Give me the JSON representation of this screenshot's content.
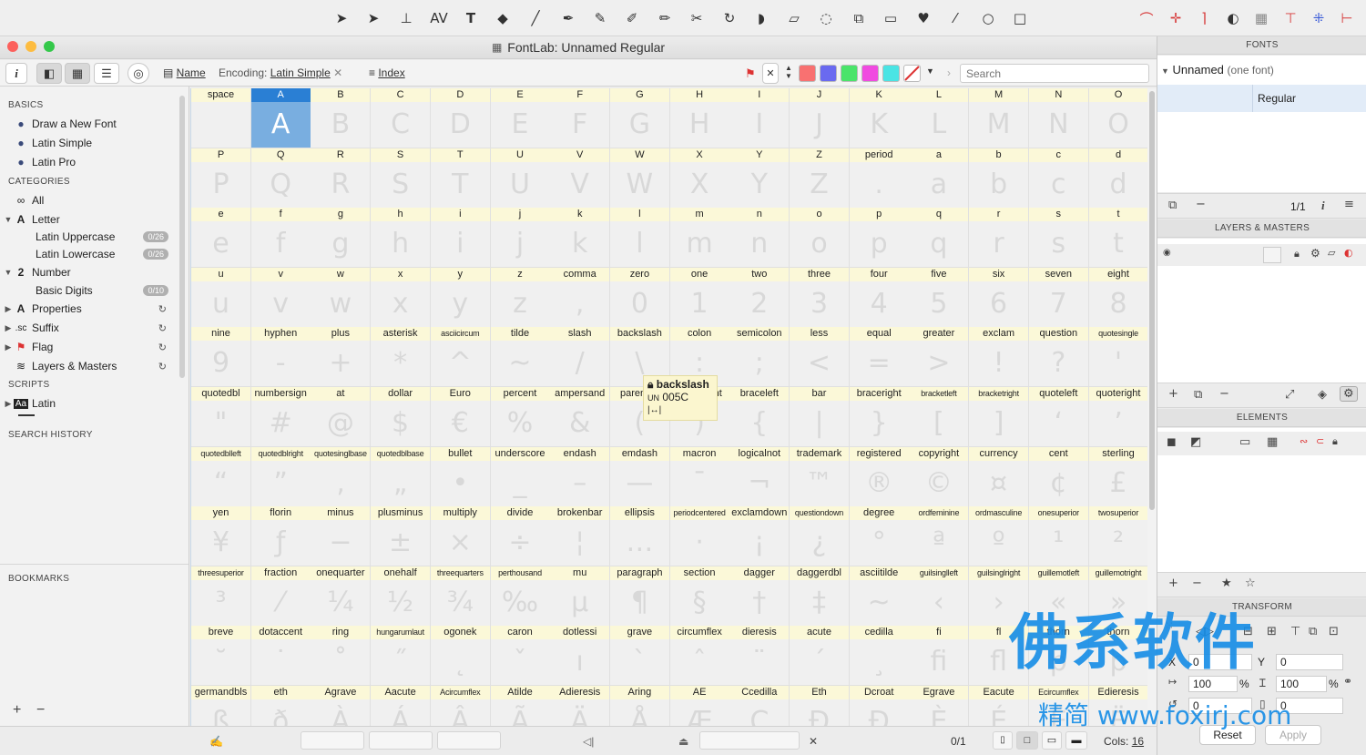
{
  "toolbar": {
    "left_icons": [
      "pointer-icon",
      "contour-pointer-icon",
      "metrics-icon",
      "kerning-icon",
      "text-icon",
      "eraser-icon",
      "brush-icon",
      "pen-icon",
      "calligraphy-icon",
      "pencil-icon",
      "rapidograph-icon",
      "knife-icon",
      "rotate-icon",
      "fill-icon",
      "ruler-icon",
      "lasso-icon",
      "transform-icon",
      "shape-icon",
      "blob-icon",
      "eyedropper-icon",
      "ellipse-icon",
      "rectangle-icon"
    ],
    "right_icons": [
      "curve-tool-icon",
      "node-tool-icon",
      "corner-tool-icon",
      "circle-tool-icon",
      "grid-tool-icon",
      "guide-tool-icon",
      "anchor-tool-icon",
      "hint-tool-icon"
    ]
  },
  "window": {
    "title": "FontLab: Unnamed Regular"
  },
  "subbar": {
    "name_label": "Name",
    "encoding_label": "Encoding:",
    "encoding_value": "Latin Simple",
    "index_label": "Index",
    "search_placeholder": "Search",
    "swatches": [
      "#f87171",
      "#6a6af0",
      "#4ae46a",
      "#f04ae0",
      "#4ae4e4"
    ]
  },
  "sidebar": {
    "basics_head": "BASICS",
    "basics": [
      "Draw a New Font",
      "Latin Simple",
      "Latin Pro"
    ],
    "categories_head": "CATEGORIES",
    "all": "All",
    "letter": "Letter",
    "latin_uppercase": "Latin Uppercase",
    "latin_uppercase_badge": "0/26",
    "latin_lowercase": "Latin Lowercase",
    "latin_lowercase_badge": "0/26",
    "number": "Number",
    "basic_digits": "Basic Digits",
    "basic_digits_badge": "0/10",
    "properties": "Properties",
    "suffix": "Suffix",
    "flag": "Flag",
    "layers_masters": "Layers & Masters",
    "scripts_head": "SCRIPTS",
    "latin": "Latin",
    "search_history_head": "SEARCH HISTORY",
    "bookmarks_head": "BOOKMARKS"
  },
  "glyphs": {
    "names": [
      "space",
      "A",
      "B",
      "C",
      "D",
      "E",
      "F",
      "G",
      "H",
      "I",
      "J",
      "K",
      "L",
      "M",
      "N",
      "O",
      "P",
      "Q",
      "R",
      "S",
      "T",
      "U",
      "V",
      "W",
      "X",
      "Y",
      "Z",
      "period",
      "a",
      "b",
      "c",
      "d",
      "e",
      "f",
      "g",
      "h",
      "i",
      "j",
      "k",
      "l",
      "m",
      "n",
      "o",
      "p",
      "q",
      "r",
      "s",
      "t",
      "u",
      "v",
      "w",
      "x",
      "y",
      "z",
      "comma",
      "zero",
      "one",
      "two",
      "three",
      "four",
      "five",
      "six",
      "seven",
      "eight",
      "nine",
      "hyphen",
      "plus",
      "asterisk",
      "asciicircum",
      "tilde",
      "slash",
      "backslash",
      "colon",
      "semicolon",
      "less",
      "equal",
      "greater",
      "exclam",
      "question",
      "quotesingle",
      "quotedbl",
      "numbersign",
      "at",
      "dollar",
      "Euro",
      "percent",
      "ampersand",
      "parenleft",
      "parenright",
      "braceleft",
      "bar",
      "braceright",
      "bracketleft",
      "bracketright",
      "quoteleft",
      "quoteright",
      "quotedblleft",
      "quotedblright",
      "quotesinglbase",
      "quotedblbase",
      "bullet",
      "underscore",
      "endash",
      "emdash",
      "macron",
      "logicalnot",
      "trademark",
      "registered",
      "copyright",
      "currency",
      "cent",
      "sterling",
      "yen",
      "florin",
      "minus",
      "plusminus",
      "multiply",
      "divide",
      "brokenbar",
      "ellipsis",
      "periodcentered",
      "exclamdown",
      "questiondown",
      "degree",
      "ordfeminine",
      "ordmasculine",
      "onesuperior",
      "twosuperior",
      "threesuperior",
      "fraction",
      "onequarter",
      "onehalf",
      "threequarters",
      "perthousand",
      "mu",
      "paragraph",
      "section",
      "dagger",
      "daggerdbl",
      "asciitilde",
      "guilsinglleft",
      "guilsinglright",
      "guillemotleft",
      "guillemotright",
      "breve",
      "dotaccent",
      "ring",
      "hungarumlaut",
      "ogonek",
      "caron",
      "dotlessi",
      "grave",
      "circumflex",
      "dieresis",
      "acute",
      "cedilla",
      "fi",
      "fl",
      "thorn",
      "thorn",
      "germandbls",
      "eth",
      "Agrave",
      "Aacute",
      "Acircumflex",
      "Atilde",
      "Adieresis",
      "Aring",
      "AE",
      "Ccedilla",
      "Eth",
      "Dcroat",
      "Egrave",
      "Eacute",
      "Ecircumflex",
      "Edieresis"
    ],
    "chars": [
      " ",
      "A",
      "B",
      "C",
      "D",
      "E",
      "F",
      "G",
      "H",
      "I",
      "J",
      "K",
      "L",
      "M",
      "N",
      "O",
      "P",
      "Q",
      "R",
      "S",
      "T",
      "U",
      "V",
      "W",
      "X",
      "Y",
      "Z",
      ".",
      "a",
      "b",
      "c",
      "d",
      "e",
      "f",
      "g",
      "h",
      "i",
      "j",
      "k",
      "l",
      "m",
      "n",
      "o",
      "p",
      "q",
      "r",
      "s",
      "t",
      "u",
      "v",
      "w",
      "x",
      "y",
      "z",
      ",",
      "0",
      "1",
      "2",
      "3",
      "4",
      "5",
      "6",
      "7",
      "8",
      "9",
      "-",
      "+",
      "*",
      "^",
      "~",
      "/",
      "\\",
      ":",
      ";",
      "<",
      "=",
      ">",
      "!",
      "?",
      "'",
      "\"",
      "#",
      "@",
      "$",
      "€",
      "%",
      "&",
      "(",
      ")",
      "{",
      "|",
      "}",
      "[",
      "]",
      "‘",
      "’",
      "“",
      "”",
      "‚",
      "„",
      "•",
      "_",
      "–",
      "—",
      "¯",
      "¬",
      "™",
      "®",
      "©",
      "¤",
      "¢",
      "£",
      "¥",
      "ƒ",
      "−",
      "±",
      "×",
      "÷",
      "¦",
      "…",
      "·",
      "¡",
      "¿",
      "°",
      "ª",
      "º",
      "¹",
      "²",
      "³",
      "⁄",
      "¼",
      "½",
      "¾",
      "‰",
      "µ",
      "¶",
      "§",
      "†",
      "‡",
      "~",
      "‹",
      "›",
      "«",
      "»",
      "˘",
      "˙",
      "˚",
      "˝",
      "˛",
      "ˇ",
      "ı",
      "`",
      "ˆ",
      "¨",
      "´",
      "¸",
      "fi",
      "fl",
      "þ",
      "þ",
      "ß",
      "ð",
      "À",
      "Á",
      "Â",
      "Ã",
      "Ä",
      "Å",
      "Æ",
      "Ç",
      "Đ",
      "Đ",
      "È",
      "É",
      "Ê",
      "Ë"
    ],
    "selected": "A",
    "tooltip": {
      "name": "backslash",
      "code": "005C",
      "unicode_label": "UN"
    }
  },
  "statusbar": {
    "count": "0/1",
    "cols_label": "Cols:",
    "cols_value": "16"
  },
  "right": {
    "fonts_head": "FONTS",
    "font_family": "Unnamed",
    "font_count": "(one font)",
    "font_style": "Regular",
    "page_count": "1/1",
    "layers_head": "LAYERS & MASTERS",
    "elements_head": "ELEMENTS",
    "transform_head": "TRANSFORM",
    "x_label": "X",
    "x_value": "0",
    "y_label": "Y",
    "y_value": "0",
    "scale_w": "100",
    "scale_h": "100",
    "percent": "%",
    "rotate_value": "0",
    "skew_value": "0",
    "reset_label": "Reset",
    "apply_label": "Apply"
  },
  "watermark": {
    "main": "佛系软件",
    "sub": "精简 www.foxirj.com"
  }
}
